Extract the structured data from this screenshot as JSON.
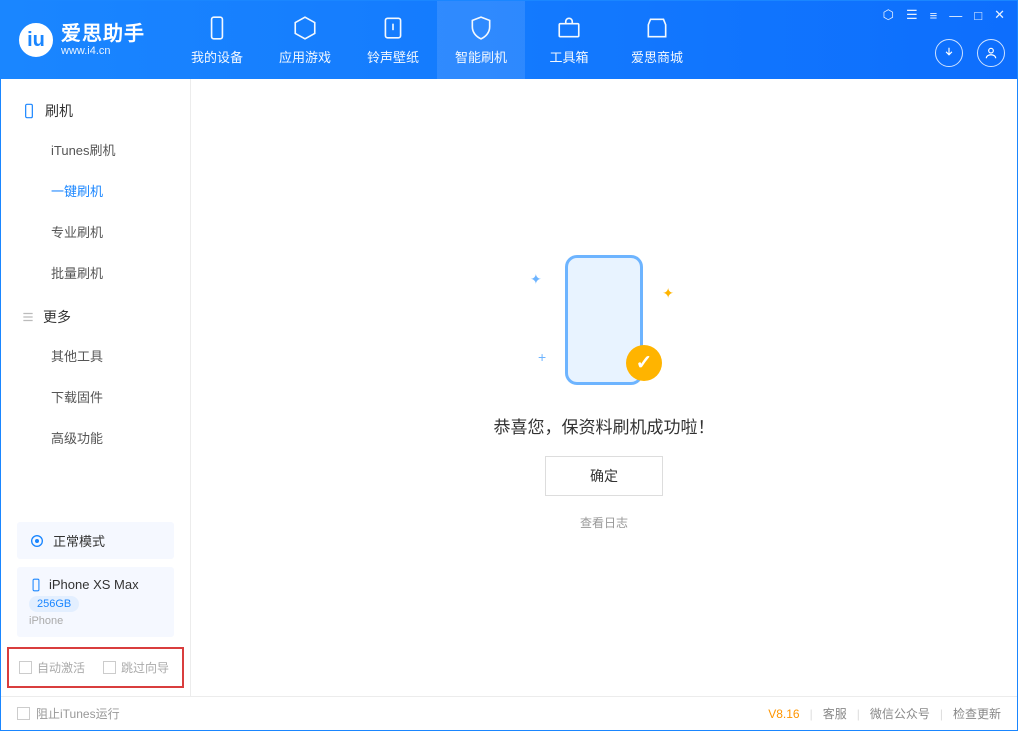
{
  "app": {
    "title": "爱思助手",
    "url": "www.i4.cn"
  },
  "topTabs": {
    "device": "我的设备",
    "apps": "应用游戏",
    "ringtone": "铃声壁纸",
    "flash": "智能刷机",
    "toolbox": "工具箱",
    "store": "爱思商城"
  },
  "sidebar": {
    "section1": {
      "title": "刷机",
      "items": [
        "iTunes刷机",
        "一键刷机",
        "专业刷机",
        "批量刷机"
      ]
    },
    "section2": {
      "title": "更多",
      "items": [
        "其他工具",
        "下载固件",
        "高级功能"
      ]
    }
  },
  "deviceStatus": {
    "mode": "正常模式",
    "name": "iPhone XS Max",
    "storage": "256GB",
    "type": "iPhone"
  },
  "bottomOptions": {
    "autoActivate": "自动激活",
    "skipGuide": "跳过向导"
  },
  "main": {
    "successText": "恭喜您，保资料刷机成功啦！",
    "confirmBtn": "确定",
    "viewLog": "查看日志"
  },
  "footer": {
    "blockItunes": "阻止iTunes运行",
    "version": "V8.16",
    "service": "客服",
    "wechat": "微信公众号",
    "update": "检查更新"
  }
}
